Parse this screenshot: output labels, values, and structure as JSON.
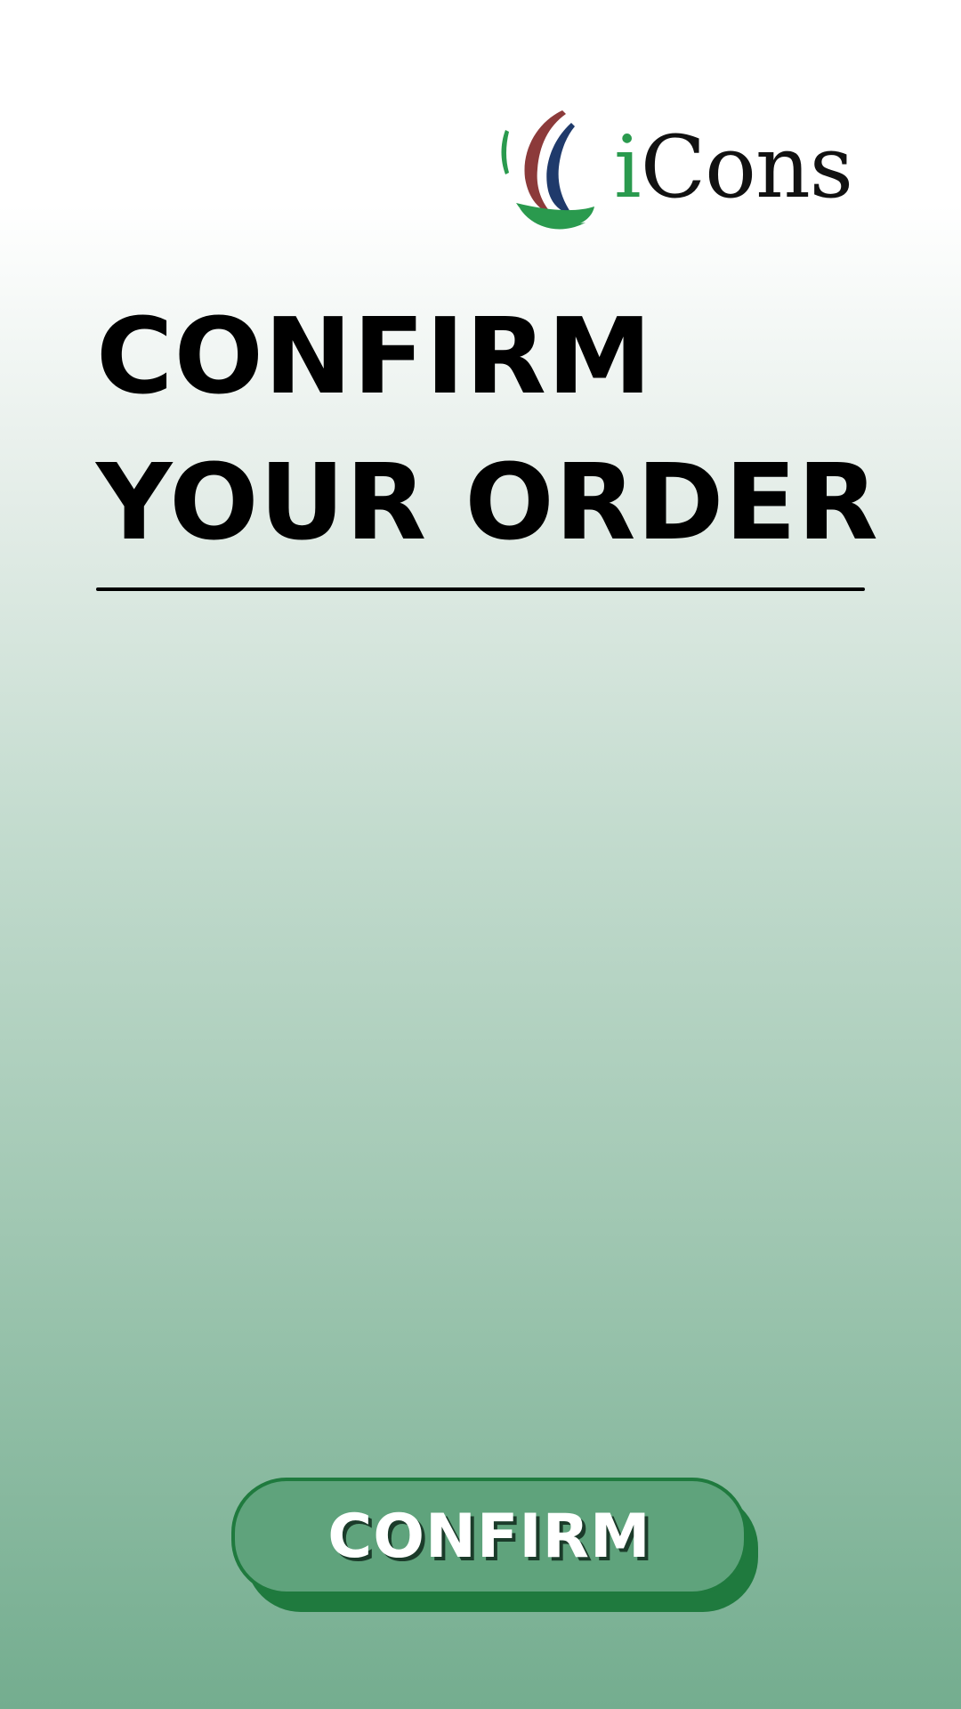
{
  "logo": {
    "text_i": "i",
    "text_rest": "Cons",
    "icon": "icons-logo-icon"
  },
  "title": {
    "line1": "CONFIRM",
    "line2": "YOUR ORDER"
  },
  "confirm_button": {
    "label": "CONFIRM"
  },
  "colors": {
    "brand_green": "#2a9a4e",
    "button_fill": "#5fa37c",
    "button_border": "#1f7a3e",
    "logo_red": "#8c3a3a",
    "logo_blue": "#1f3a6b",
    "gradient_top": "#ffffff",
    "gradient_bottom": "#74ad8f"
  }
}
